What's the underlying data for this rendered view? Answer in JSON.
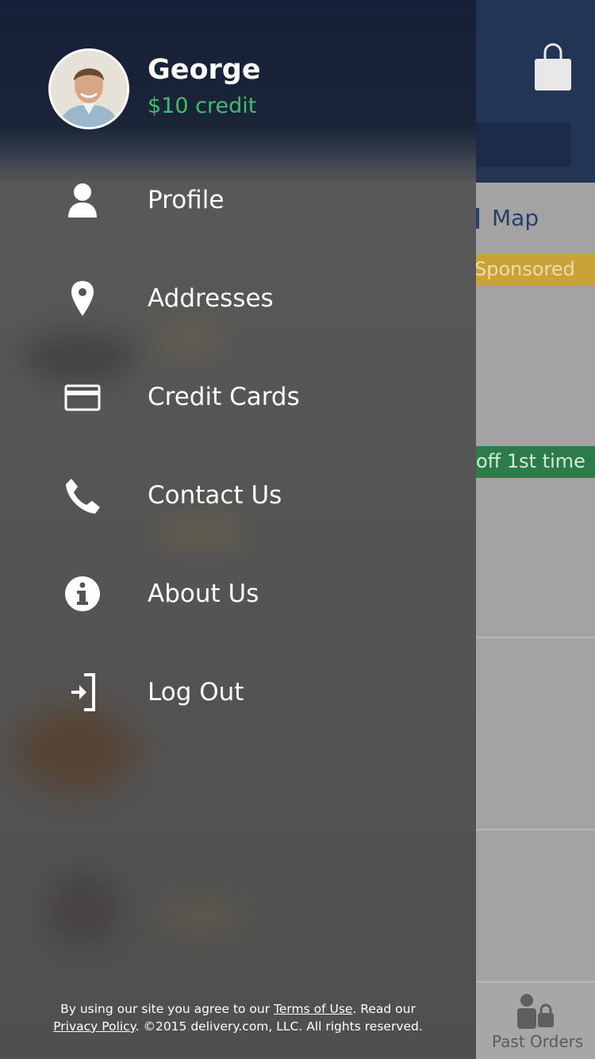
{
  "user": {
    "name": "George",
    "credit": "$10 credit"
  },
  "menu": {
    "items": [
      {
        "label": "Profile",
        "icon": "person-icon"
      },
      {
        "label": "Addresses",
        "icon": "map-pin-icon"
      },
      {
        "label": "Credit Cards",
        "icon": "credit-card-icon"
      },
      {
        "label": "Contact Us",
        "icon": "phone-icon"
      },
      {
        "label": "About Us",
        "icon": "info-icon"
      },
      {
        "label": "Log Out",
        "icon": "logout-icon"
      }
    ]
  },
  "legal": {
    "prefix": "By using our site you agree to our ",
    "terms_link": "Terms of Use",
    "middle": ". Read our",
    "privacy_link": "Privacy Policy",
    "suffix": ". ©2015 delivery.com, LLC. All rights reserved."
  },
  "background": {
    "map_label": "Map",
    "sponsored_label": "Sponsored",
    "promo_label": "off 1st time",
    "tab_past_orders": "Past Orders",
    "header_icon": "shopping-bag-icon"
  },
  "colors": {
    "header_navy": "#152038",
    "drawer_gray": "#555555",
    "credit_green": "#3fbf6a",
    "sponsored_gold": "#c9a23a",
    "promo_green": "#2d7a4a"
  }
}
